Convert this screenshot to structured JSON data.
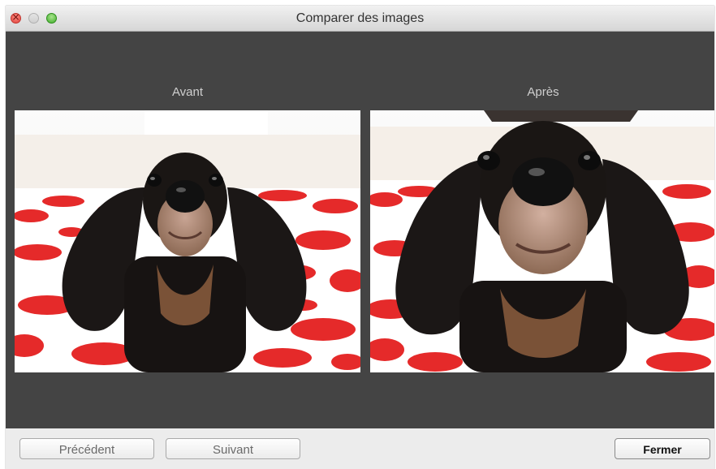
{
  "window": {
    "title": "Comparer des images"
  },
  "compare": {
    "before_label": "Avant",
    "after_label": "Après"
  },
  "buttons": {
    "previous": "Précédent",
    "next": "Suivant",
    "close": "Fermer"
  },
  "colors": {
    "stage_background": "#444444",
    "close_light": "#e0443e",
    "zoom_light": "#3fae2a"
  }
}
